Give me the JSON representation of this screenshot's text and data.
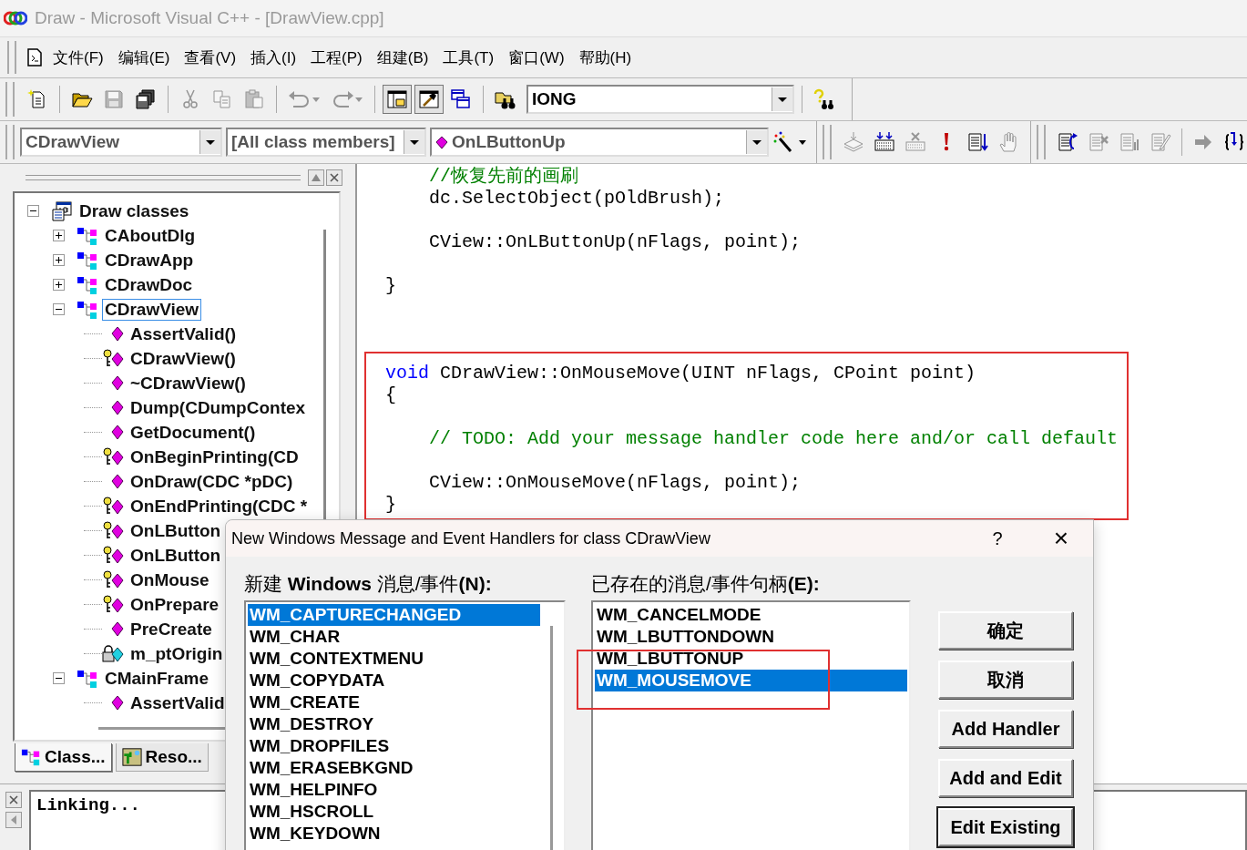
{
  "window": {
    "title": "Draw - Microsoft Visual C++ - [DrawView.cpp]"
  },
  "menu": [
    "文件(F)",
    "编辑(E)",
    "查看(V)",
    "插入(I)",
    "工程(P)",
    "组建(B)",
    "工具(T)",
    "窗口(W)",
    "帮助(H)"
  ],
  "standard_toolbar": [
    {
      "kind": "new_text",
      "disabled": false,
      "pressed": false
    },
    {
      "kind": "separator"
    },
    {
      "kind": "open",
      "disabled": false,
      "pressed": false
    },
    {
      "kind": "save",
      "disabled": true,
      "pressed": false
    },
    {
      "kind": "save_all",
      "disabled": false,
      "pressed": false
    },
    {
      "kind": "separator"
    },
    {
      "kind": "cut",
      "disabled": true,
      "pressed": false
    },
    {
      "kind": "copy",
      "disabled": true,
      "pressed": false
    },
    {
      "kind": "paste",
      "disabled": true,
      "pressed": false
    },
    {
      "kind": "separator"
    },
    {
      "kind": "undo",
      "disabled": true,
      "pressed": false
    },
    {
      "kind": "redo",
      "disabled": true,
      "pressed": false
    },
    {
      "kind": "separator"
    },
    {
      "kind": "workspace",
      "disabled": false,
      "pressed": true
    },
    {
      "kind": "output",
      "disabled": false,
      "pressed": true
    },
    {
      "kind": "windows",
      "disabled": false,
      "pressed": false
    },
    {
      "kind": "separator"
    },
    {
      "kind": "find_files",
      "disabled": false,
      "pressed": false
    },
    {
      "kind": "combo",
      "value": "IONG"
    },
    {
      "kind": "separator"
    },
    {
      "kind": "help_search",
      "disabled": false,
      "pressed": false
    }
  ],
  "wizard_bar": {
    "class_combo": "CDrawView",
    "filter_combo": "[All class members]",
    "member_combo": "OnLButtonUp"
  },
  "build_toolbar": [
    {
      "kind": "compile",
      "disabled": true
    },
    {
      "kind": "build",
      "disabled": false
    },
    {
      "kind": "stop_build",
      "disabled": true
    },
    {
      "kind": "execute",
      "disabled": false
    },
    {
      "kind": "go",
      "disabled": false
    },
    {
      "kind": "breakpoint",
      "disabled": true
    }
  ],
  "edit_toolbar": [
    {
      "kind": "goto_def",
      "disabled": false
    },
    {
      "kind": "page_cross",
      "disabled": true
    },
    {
      "kind": "page_bars",
      "disabled": true
    },
    {
      "kind": "page_pencil",
      "disabled": true
    },
    {
      "kind": "separator"
    },
    {
      "kind": "step_arrow",
      "disabled": true
    },
    {
      "kind": "braces",
      "disabled": false
    }
  ],
  "class_view": {
    "tree": [
      {
        "label": "Draw classes",
        "kind": "root",
        "expanded": true,
        "selected": false,
        "children": [
          {
            "label": "CAboutDlg",
            "kind": "class",
            "expanded": false,
            "selected": false
          },
          {
            "label": "CDrawApp",
            "kind": "class",
            "expanded": false,
            "selected": false
          },
          {
            "label": "CDrawDoc",
            "kind": "class",
            "expanded": false,
            "selected": false
          },
          {
            "label": "CDrawView",
            "kind": "class",
            "expanded": true,
            "selected": true,
            "children": [
              {
                "label": "AssertValid()",
                "kind": "method",
                "selected": false
              },
              {
                "label": "CDrawView()",
                "kind": "protected_method",
                "selected": false
              },
              {
                "label": "~CDrawView()",
                "kind": "method",
                "selected": false
              },
              {
                "label": "Dump(CDumpContex",
                "kind": "method",
                "selected": false
              },
              {
                "label": "GetDocument()",
                "kind": "method",
                "selected": false
              },
              {
                "label": "OnBeginPrinting(CD",
                "kind": "protected_method",
                "selected": false
              },
              {
                "label": "OnDraw(CDC *pDC)",
                "kind": "method",
                "selected": false
              },
              {
                "label": "OnEndPrinting(CDC *",
                "kind": "protected_method",
                "selected": false
              },
              {
                "label": "OnLButton",
                "kind": "protected_method",
                "selected": false
              },
              {
                "label": "OnLButton",
                "kind": "protected_method",
                "selected": false
              },
              {
                "label": "OnMouse",
                "kind": "protected_method",
                "selected": false
              },
              {
                "label": "OnPrepare",
                "kind": "protected_method",
                "selected": false
              },
              {
                "label": "PreCreate",
                "kind": "method",
                "selected": false
              },
              {
                "label": "m_ptOrigin",
                "kind": "private_member",
                "selected": false
              }
            ]
          },
          {
            "label": "CMainFrame",
            "kind": "class",
            "expanded": true,
            "selected": false,
            "children": [
              {
                "label": "AssertValid",
                "kind": "method",
                "selected": false
              }
            ]
          }
        ]
      }
    ],
    "tabs": [
      {
        "label": "Class...",
        "kind": "class",
        "selected": true
      },
      {
        "label": "Reso...",
        "kind": "resource",
        "selected": false
      }
    ]
  },
  "editor": {
    "sections": [
      {
        "highlighted": false,
        "blocks": [
          [
            {
              "kind": "comment",
              "indent": true,
              "text": "//恢复先前的画刷"
            },
            {
              "kind": "code",
              "indent": true,
              "text": "dc.SelectObject(pOldBrush);"
            }
          ],
          [
            {
              "kind": "code",
              "indent": true,
              "text": "CView::OnLButtonUp(nFlags, point);"
            }
          ],
          [
            {
              "kind": "code",
              "indent": false,
              "text": "}"
            }
          ]
        ]
      },
      {
        "highlighted": true,
        "blocks": [
          [
            {
              "kind": "declaration",
              "indent": false,
              "keyword": "void",
              "text": "CDrawView::OnMouseMove(UINT nFlags, CPoint point)"
            },
            {
              "kind": "code",
              "indent": false,
              "text": "{"
            }
          ],
          [
            {
              "kind": "comment",
              "indent": true,
              "text": "// TODO: Add your message handler code here and/or call default"
            }
          ],
          [
            {
              "kind": "code",
              "indent": true,
              "text": "CView::OnMouseMove(nFlags, point);"
            },
            {
              "kind": "code",
              "indent": false,
              "text": "}"
            }
          ]
        ]
      }
    ]
  },
  "output": {
    "lines": [
      "Linking..."
    ]
  },
  "dialog": {
    "title": "New Windows Message and Event Handlers for class CDrawView",
    "help_button": "?",
    "close_button": "×",
    "new_messages": {
      "label": "新建 **Windows** 消息/事件**(N):**",
      "items": [
        {
          "text": "WM_CAPTURECHANGED",
          "selected": true
        },
        {
          "text": "WM_CHAR",
          "selected": false
        },
        {
          "text": "WM_CONTEXTMENU",
          "selected": false
        },
        {
          "text": "WM_COPYDATA",
          "selected": false
        },
        {
          "text": "WM_CREATE",
          "selected": false
        },
        {
          "text": "WM_DESTROY",
          "selected": false
        },
        {
          "text": "WM_DROPFILES",
          "selected": false
        },
        {
          "text": "WM_ERASEBKGND",
          "selected": false
        },
        {
          "text": "WM_HELPINFO",
          "selected": false
        },
        {
          "text": "WM_HSCROLL",
          "selected": false
        },
        {
          "text": "WM_KEYDOWN",
          "selected": false
        }
      ]
    },
    "existing_handlers": {
      "label": "已存在的消息/事件句柄**(E):**",
      "highlighted": true,
      "items": [
        {
          "text": "WM_CANCELMODE",
          "selected": false
        },
        {
          "text": "WM_LBUTTONDOWN",
          "selected": false
        },
        {
          "text": "WM_LBUTTONUP",
          "selected": false
        },
        {
          "text": "WM_MOUSEMOVE",
          "selected": true
        }
      ]
    },
    "buttons": [
      {
        "label": "确定",
        "default": false
      },
      {
        "label": "取消",
        "default": false
      },
      {
        "label": "Add Handler",
        "default": false
      },
      {
        "label": "Add and Edit",
        "default": false
      },
      {
        "label": "Edit Existing",
        "default": true
      }
    ]
  }
}
